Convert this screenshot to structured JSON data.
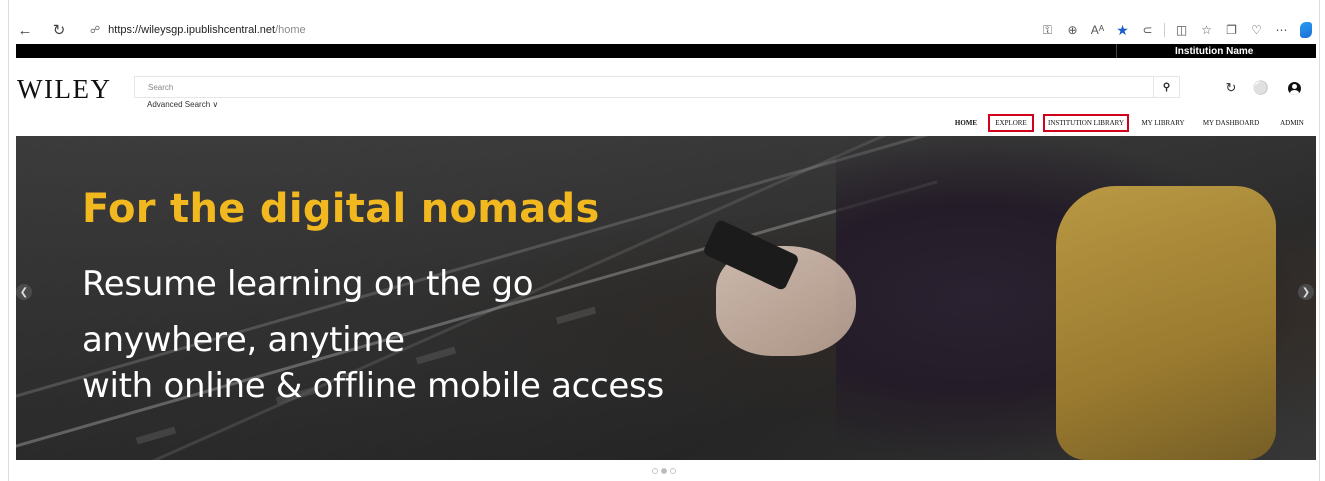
{
  "browser": {
    "back_icon": "back-arrow-icon",
    "refresh_icon": "refresh-icon",
    "url_host": "https://wileysgp.ipublishcentral.net",
    "url_path": "/home"
  },
  "institution": {
    "name": "Institution Name"
  },
  "header": {
    "logo": "WILEY",
    "search_placeholder": "Search",
    "advanced_search": "Advanced Search ∨"
  },
  "nav": {
    "items": [
      {
        "label": "HOME"
      },
      {
        "label": "EXPLORE"
      },
      {
        "label": "INSTITUTION LIBRARY"
      },
      {
        "label": "MY LIBRARY"
      },
      {
        "label": "MY DASHBOARD"
      },
      {
        "label": "ADMIN"
      }
    ]
  },
  "hero": {
    "title": "For the digital nomads",
    "line1": "Resume learning on the go",
    "line2": "anywhere, anytime",
    "line3": "with online & offline mobile access",
    "accent_color": "#f2b81f"
  },
  "carousel": {
    "slide_count": 3,
    "active_slide": 2
  }
}
